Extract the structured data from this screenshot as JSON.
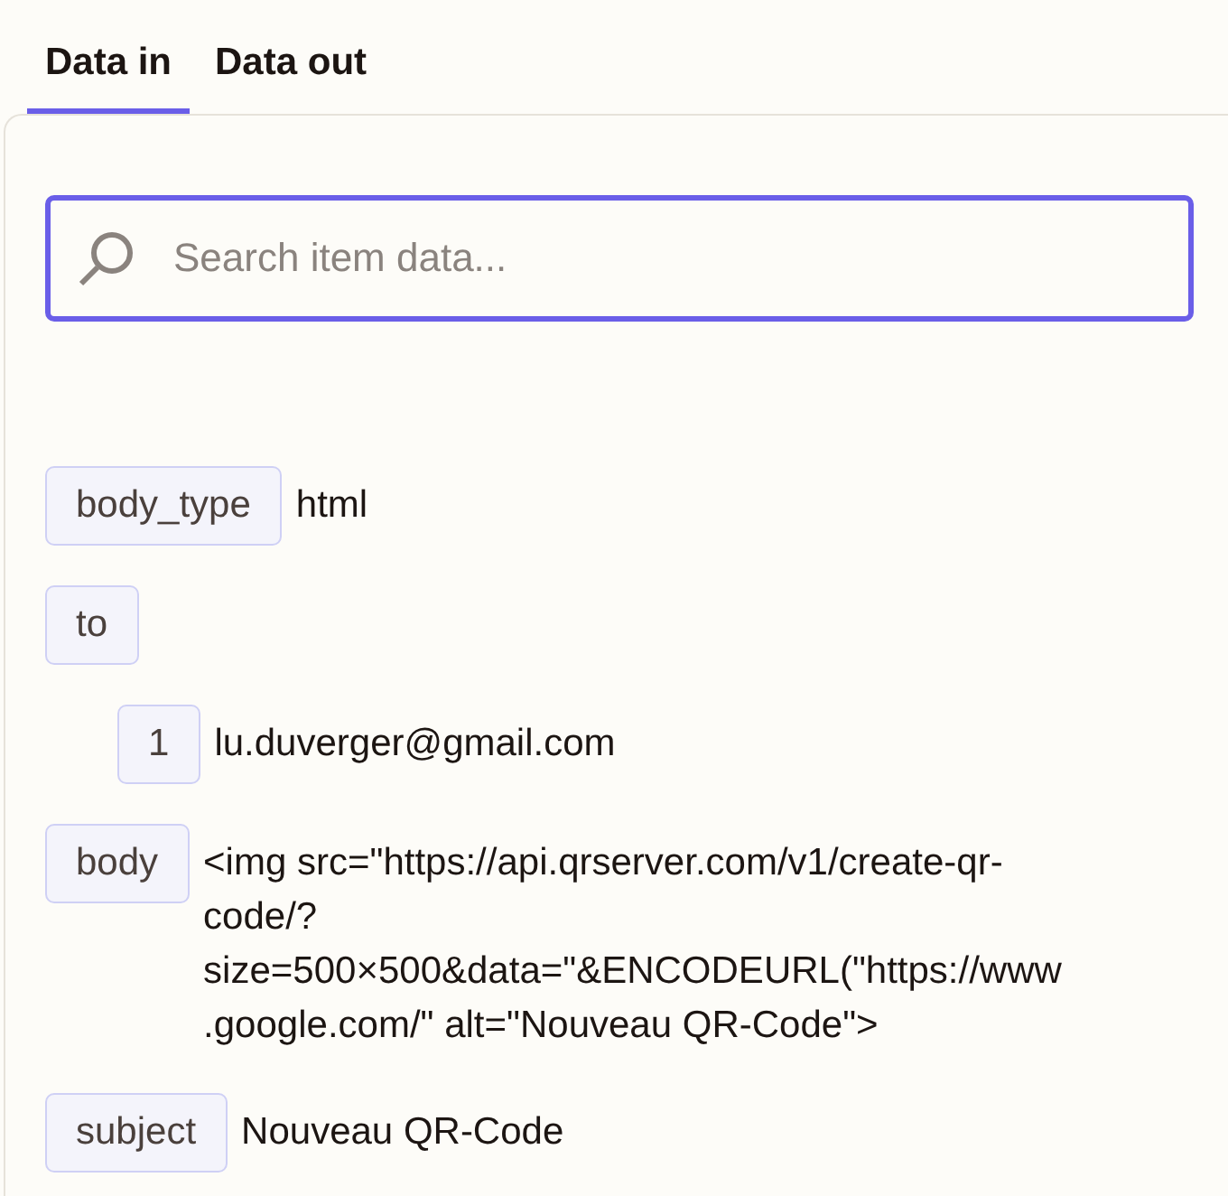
{
  "tabs": [
    {
      "label": "Data in",
      "selected": true
    },
    {
      "label": "Data out",
      "selected": false
    }
  ],
  "search": {
    "placeholder": "Search item data..."
  },
  "fields": [
    {
      "key": "body_type",
      "value": "html"
    },
    {
      "key": "to",
      "children": [
        {
          "key": "1",
          "value": "lu.duverger@gmail.com"
        }
      ]
    },
    {
      "key": "body",
      "value": "<img src=\"https://api.qrserver.com/v1/create-qr-code/?size=500×500&data=\"&ENCODEURL(\"https://www.google.com/\" alt=\"Nouveau QR-Code\">"
    },
    {
      "key": "subject",
      "value": "Nouveau QR-Code"
    }
  ]
}
